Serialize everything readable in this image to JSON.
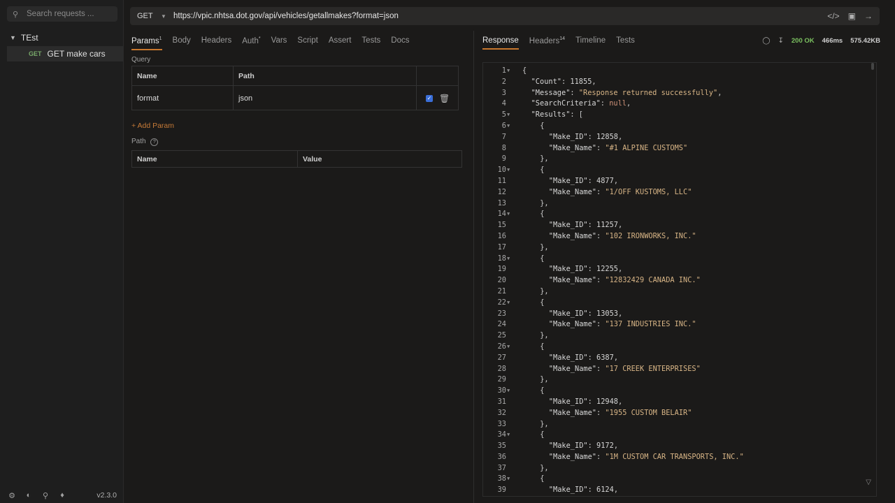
{
  "sidebar": {
    "search_placeholder": "Search requests ...",
    "collection_name": "TEst",
    "request": {
      "method": "GET",
      "name": "GET make cars"
    },
    "version": "v2.3.0"
  },
  "request": {
    "method": "GET",
    "url": "https://vpic.nhtsa.dot.gov/api/vehicles/getallmakes?format=json"
  },
  "request_tabs": [
    {
      "label": "Params",
      "badge": "1",
      "active": true
    },
    {
      "label": "Body",
      "badge": ""
    },
    {
      "label": "Headers",
      "badge": ""
    },
    {
      "label": "Auth",
      "badge": "*"
    },
    {
      "label": "Vars",
      "badge": ""
    },
    {
      "label": "Script",
      "badge": ""
    },
    {
      "label": "Assert",
      "badge": ""
    },
    {
      "label": "Tests",
      "badge": ""
    },
    {
      "label": "Docs",
      "badge": ""
    }
  ],
  "params": {
    "query_label": "Query",
    "query_headers": {
      "name": "Name",
      "path": "Path"
    },
    "query_rows": [
      {
        "name": "format",
        "value": "json",
        "enabled": true
      }
    ],
    "add_param": "+ Add Param",
    "path_label": "Path",
    "path_headers": {
      "name": "Name",
      "value": "Value"
    }
  },
  "response_tabs": [
    {
      "label": "Response",
      "badge": "",
      "active": true
    },
    {
      "label": "Headers",
      "badge": "14"
    },
    {
      "label": "Timeline",
      "badge": ""
    },
    {
      "label": "Tests",
      "badge": ""
    }
  ],
  "response_meta": {
    "status": "200 OK",
    "time": "466ms",
    "size": "575.42KB"
  },
  "response_lines": [
    {
      "n": "1",
      "fold": true,
      "indent": 0,
      "parts": [
        [
          "p",
          "{"
        ]
      ]
    },
    {
      "n": "2",
      "fold": false,
      "indent": 1,
      "parts": [
        [
          "k",
          "\"Count\""
        ],
        [
          "p",
          ": "
        ],
        [
          "n",
          "11855"
        ],
        [
          "p",
          ","
        ]
      ]
    },
    {
      "n": "3",
      "fold": false,
      "indent": 1,
      "parts": [
        [
          "k",
          "\"Message\""
        ],
        [
          "p",
          ": "
        ],
        [
          "s",
          "\"Response returned successfully\""
        ],
        [
          "p",
          ","
        ]
      ]
    },
    {
      "n": "4",
      "fold": false,
      "indent": 1,
      "parts": [
        [
          "k",
          "\"SearchCriteria\""
        ],
        [
          "p",
          ": "
        ],
        [
          "nl",
          "null"
        ],
        [
          "p",
          ","
        ]
      ]
    },
    {
      "n": "5",
      "fold": true,
      "indent": 1,
      "parts": [
        [
          "k",
          "\"Results\""
        ],
        [
          "p",
          ": ["
        ]
      ]
    },
    {
      "n": "6",
      "fold": true,
      "indent": 2,
      "parts": [
        [
          "p",
          "{"
        ]
      ]
    },
    {
      "n": "7",
      "fold": false,
      "indent": 3,
      "parts": [
        [
          "k",
          "\"Make_ID\""
        ],
        [
          "p",
          ": "
        ],
        [
          "n",
          "12858"
        ],
        [
          "p",
          ","
        ]
      ]
    },
    {
      "n": "8",
      "fold": false,
      "indent": 3,
      "parts": [
        [
          "k",
          "\"Make_Name\""
        ],
        [
          "p",
          ": "
        ],
        [
          "s",
          "\"#1 ALPINE CUSTOMS\""
        ]
      ]
    },
    {
      "n": "9",
      "fold": false,
      "indent": 2,
      "parts": [
        [
          "p",
          "},"
        ]
      ]
    },
    {
      "n": "10",
      "fold": true,
      "indent": 2,
      "parts": [
        [
          "p",
          "{"
        ]
      ]
    },
    {
      "n": "11",
      "fold": false,
      "indent": 3,
      "parts": [
        [
          "k",
          "\"Make_ID\""
        ],
        [
          "p",
          ": "
        ],
        [
          "n",
          "4877"
        ],
        [
          "p",
          ","
        ]
      ]
    },
    {
      "n": "12",
      "fold": false,
      "indent": 3,
      "parts": [
        [
          "k",
          "\"Make_Name\""
        ],
        [
          "p",
          ": "
        ],
        [
          "s",
          "\"1/OFF KUSTOMS, LLC\""
        ]
      ]
    },
    {
      "n": "13",
      "fold": false,
      "indent": 2,
      "parts": [
        [
          "p",
          "},"
        ]
      ]
    },
    {
      "n": "14",
      "fold": true,
      "indent": 2,
      "parts": [
        [
          "p",
          "{"
        ]
      ]
    },
    {
      "n": "15",
      "fold": false,
      "indent": 3,
      "parts": [
        [
          "k",
          "\"Make_ID\""
        ],
        [
          "p",
          ": "
        ],
        [
          "n",
          "11257"
        ],
        [
          "p",
          ","
        ]
      ]
    },
    {
      "n": "16",
      "fold": false,
      "indent": 3,
      "parts": [
        [
          "k",
          "\"Make_Name\""
        ],
        [
          "p",
          ": "
        ],
        [
          "s",
          "\"102 IRONWORKS, INC.\""
        ]
      ]
    },
    {
      "n": "17",
      "fold": false,
      "indent": 2,
      "parts": [
        [
          "p",
          "},"
        ]
      ]
    },
    {
      "n": "18",
      "fold": true,
      "indent": 2,
      "parts": [
        [
          "p",
          "{"
        ]
      ]
    },
    {
      "n": "19",
      "fold": false,
      "indent": 3,
      "parts": [
        [
          "k",
          "\"Make_ID\""
        ],
        [
          "p",
          ": "
        ],
        [
          "n",
          "12255"
        ],
        [
          "p",
          ","
        ]
      ]
    },
    {
      "n": "20",
      "fold": false,
      "indent": 3,
      "parts": [
        [
          "k",
          "\"Make_Name\""
        ],
        [
          "p",
          ": "
        ],
        [
          "s",
          "\"12832429 CANADA INC.\""
        ]
      ]
    },
    {
      "n": "21",
      "fold": false,
      "indent": 2,
      "parts": [
        [
          "p",
          "},"
        ]
      ]
    },
    {
      "n": "22",
      "fold": true,
      "indent": 2,
      "parts": [
        [
          "p",
          "{"
        ]
      ]
    },
    {
      "n": "23",
      "fold": false,
      "indent": 3,
      "parts": [
        [
          "k",
          "\"Make_ID\""
        ],
        [
          "p",
          ": "
        ],
        [
          "n",
          "13053"
        ],
        [
          "p",
          ","
        ]
      ]
    },
    {
      "n": "24",
      "fold": false,
      "indent": 3,
      "parts": [
        [
          "k",
          "\"Make_Name\""
        ],
        [
          "p",
          ": "
        ],
        [
          "s",
          "\"137 INDUSTRIES INC.\""
        ]
      ]
    },
    {
      "n": "25",
      "fold": false,
      "indent": 2,
      "parts": [
        [
          "p",
          "},"
        ]
      ]
    },
    {
      "n": "26",
      "fold": true,
      "indent": 2,
      "parts": [
        [
          "p",
          "{"
        ]
      ]
    },
    {
      "n": "27",
      "fold": false,
      "indent": 3,
      "parts": [
        [
          "k",
          "\"Make_ID\""
        ],
        [
          "p",
          ": "
        ],
        [
          "n",
          "6387"
        ],
        [
          "p",
          ","
        ]
      ]
    },
    {
      "n": "28",
      "fold": false,
      "indent": 3,
      "parts": [
        [
          "k",
          "\"Make_Name\""
        ],
        [
          "p",
          ": "
        ],
        [
          "s",
          "\"17 CREEK ENTERPRISES\""
        ]
      ]
    },
    {
      "n": "29",
      "fold": false,
      "indent": 2,
      "parts": [
        [
          "p",
          "},"
        ]
      ]
    },
    {
      "n": "30",
      "fold": true,
      "indent": 2,
      "parts": [
        [
          "p",
          "{"
        ]
      ]
    },
    {
      "n": "31",
      "fold": false,
      "indent": 3,
      "parts": [
        [
          "k",
          "\"Make_ID\""
        ],
        [
          "p",
          ": "
        ],
        [
          "n",
          "12948"
        ],
        [
          "p",
          ","
        ]
      ]
    },
    {
      "n": "32",
      "fold": false,
      "indent": 3,
      "parts": [
        [
          "k",
          "\"Make_Name\""
        ],
        [
          "p",
          ": "
        ],
        [
          "s",
          "\"1955 CUSTOM BELAIR\""
        ]
      ]
    },
    {
      "n": "33",
      "fold": false,
      "indent": 2,
      "parts": [
        [
          "p",
          "},"
        ]
      ]
    },
    {
      "n": "34",
      "fold": true,
      "indent": 2,
      "parts": [
        [
          "p",
          "{"
        ]
      ]
    },
    {
      "n": "35",
      "fold": false,
      "indent": 3,
      "parts": [
        [
          "k",
          "\"Make_ID\""
        ],
        [
          "p",
          ": "
        ],
        [
          "n",
          "9172"
        ],
        [
          "p",
          ","
        ]
      ]
    },
    {
      "n": "36",
      "fold": false,
      "indent": 3,
      "parts": [
        [
          "k",
          "\"Make_Name\""
        ],
        [
          "p",
          ": "
        ],
        [
          "s",
          "\"1M CUSTOM CAR TRANSPORTS, INC.\""
        ]
      ]
    },
    {
      "n": "37",
      "fold": false,
      "indent": 2,
      "parts": [
        [
          "p",
          "},"
        ]
      ]
    },
    {
      "n": "38",
      "fold": true,
      "indent": 2,
      "parts": [
        [
          "p",
          "{"
        ]
      ]
    },
    {
      "n": "39",
      "fold": false,
      "indent": 3,
      "parts": [
        [
          "k",
          "\"Make_ID\""
        ],
        [
          "p",
          ": "
        ],
        [
          "n",
          "6124"
        ],
        [
          "p",
          ","
        ]
      ]
    }
  ]
}
